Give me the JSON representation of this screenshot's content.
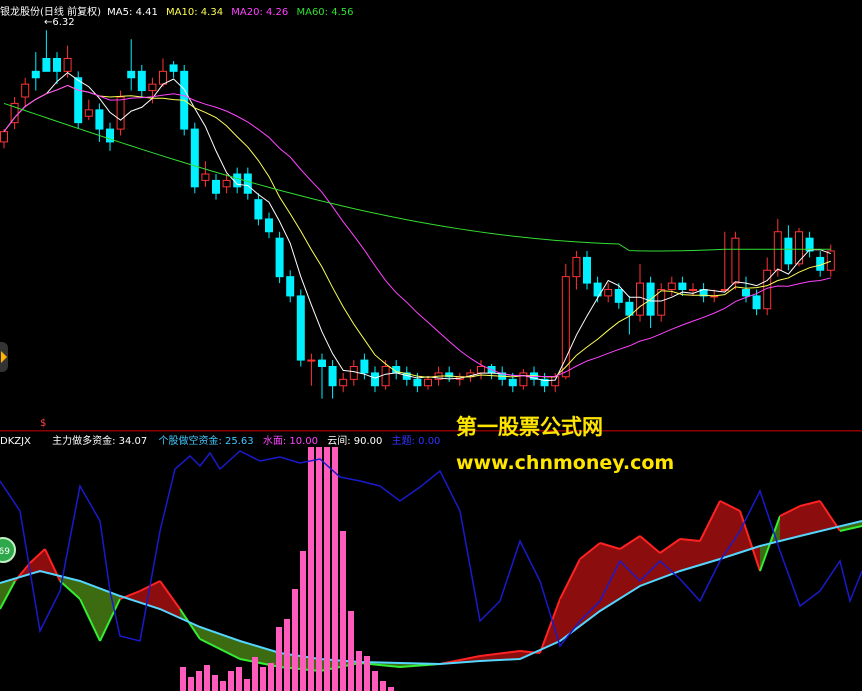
{
  "price_panel": {
    "title": "银龙股份(日线 前复权)",
    "ma_labels": [
      {
        "name": "MA5",
        "value": "4.41",
        "color": "#ffffff"
      },
      {
        "name": "MA10",
        "value": "4.34",
        "color": "#ffff55"
      },
      {
        "name": "MA20",
        "value": "4.26",
        "color": "#ff44ff"
      },
      {
        "name": "MA60",
        "value": "4.56",
        "color": "#33dd33"
      }
    ],
    "high_marker": "6.32",
    "up_color": "#ff3333",
    "down_color": "#00f0ff"
  },
  "indicator_panel": {
    "name": "DKZJX",
    "labels": [
      {
        "text": "主力做多资金: 34.07",
        "color": "#ffffff"
      },
      {
        "text": "个股做空资金: 25.63",
        "color": "#41c8ff"
      },
      {
        "text": "水面: 10.00",
        "color": "#ff44ff"
      },
      {
        "text": "云间: 90.00",
        "color": "#ffffff"
      },
      {
        "text": "主题: 0.00",
        "color": "#3333ff"
      }
    ],
    "side_badge": "69",
    "marker": "$"
  },
  "watermark": {
    "line1": "第一股票公式网",
    "line2": "www.chnmoney.com"
  },
  "chart_data": {
    "type": "candlestick",
    "price_axis_hint": "approx 3.4 - 6.4",
    "series": [
      {
        "name": "MA5",
        "color": "#ffffff"
      },
      {
        "name": "MA10",
        "color": "#ffff55"
      },
      {
        "name": "MA20",
        "color": "#ff44ff"
      },
      {
        "name": "MA60",
        "color": "#33dd33"
      }
    ],
    "candles": [
      [
        5.45,
        5.53,
        5.55,
        5.4
      ],
      [
        5.6,
        5.75,
        5.8,
        5.55
      ],
      [
        5.8,
        5.9,
        5.95,
        5.72
      ],
      [
        6.0,
        5.95,
        6.15,
        5.85
      ],
      [
        6.1,
        6.0,
        6.32,
        6.05
      ],
      [
        6.1,
        6.0,
        6.15,
        5.9
      ],
      [
        6.0,
        6.1,
        6.2,
        5.95
      ],
      [
        5.95,
        5.6,
        6.0,
        5.55
      ],
      [
        5.65,
        5.7,
        5.78,
        5.62
      ],
      [
        5.7,
        5.55,
        5.75,
        5.45
      ],
      [
        5.55,
        5.45,
        5.6,
        5.38
      ],
      [
        5.55,
        5.8,
        5.85,
        5.5
      ],
      [
        6.0,
        5.95,
        6.25,
        5.85
      ],
      [
        6.0,
        5.85,
        6.05,
        5.8
      ],
      [
        5.85,
        5.9,
        5.95,
        5.75
      ],
      [
        5.9,
        6.0,
        6.1,
        5.88
      ],
      [
        6.05,
        6.0,
        6.08,
        5.95
      ],
      [
        6.0,
        5.55,
        6.05,
        5.5
      ],
      [
        5.55,
        5.1,
        5.6,
        5.05
      ],
      [
        5.15,
        5.2,
        5.3,
        5.1
      ],
      [
        5.15,
        5.05,
        5.2,
        5.0
      ],
      [
        5.1,
        5.15,
        5.2,
        5.05
      ],
      [
        5.2,
        5.1,
        5.25,
        5.05
      ],
      [
        5.2,
        5.05,
        5.25,
        5.0
      ],
      [
        5.0,
        4.85,
        5.05,
        4.8
      ],
      [
        4.85,
        4.75,
        4.9,
        4.7
      ],
      [
        4.7,
        4.4,
        4.75,
        4.35
      ],
      [
        4.4,
        4.25,
        4.45,
        4.2
      ],
      [
        4.25,
        3.75,
        4.3,
        3.7
      ],
      [
        3.75,
        3.75,
        3.8,
        3.55
      ],
      [
        3.75,
        3.7,
        3.8,
        3.45
      ],
      [
        3.7,
        3.55,
        3.75,
        3.45
      ],
      [
        3.55,
        3.6,
        3.65,
        3.5
      ],
      [
        3.6,
        3.7,
        3.75,
        3.55
      ],
      [
        3.75,
        3.65,
        3.8,
        3.6
      ],
      [
        3.65,
        3.55,
        3.7,
        3.5
      ],
      [
        3.55,
        3.7,
        3.75,
        3.52
      ],
      [
        3.7,
        3.65,
        3.75,
        3.6
      ],
      [
        3.65,
        3.6,
        3.7,
        3.55
      ],
      [
        3.6,
        3.55,
        3.65,
        3.5
      ],
      [
        3.55,
        3.6,
        3.62,
        3.52
      ],
      [
        3.6,
        3.65,
        3.7,
        3.55
      ],
      [
        3.65,
        3.62,
        3.7,
        3.58
      ],
      [
        3.6,
        3.62,
        3.65,
        3.55
      ],
      [
        3.62,
        3.65,
        3.68,
        3.58
      ],
      [
        3.65,
        3.7,
        3.75,
        3.6
      ],
      [
        3.7,
        3.65,
        3.72,
        3.6
      ],
      [
        3.65,
        3.6,
        3.7,
        3.55
      ],
      [
        3.6,
        3.55,
        3.65,
        3.5
      ],
      [
        3.55,
        3.65,
        3.68,
        3.52
      ],
      [
        3.65,
        3.6,
        3.7,
        3.55
      ],
      [
        3.6,
        3.55,
        3.65,
        3.5
      ],
      [
        3.55,
        3.62,
        3.65,
        3.5
      ],
      [
        3.62,
        4.4,
        4.5,
        3.6
      ],
      [
        4.4,
        4.55,
        4.6,
        4.3
      ],
      [
        4.55,
        4.35,
        4.6,
        4.3
      ],
      [
        4.35,
        4.25,
        4.4,
        4.2
      ],
      [
        4.25,
        4.3,
        4.35,
        4.2
      ],
      [
        4.3,
        4.2,
        4.35,
        4.15
      ],
      [
        4.2,
        4.1,
        4.25,
        3.95
      ],
      [
        4.1,
        4.35,
        4.5,
        4.05
      ],
      [
        4.35,
        4.1,
        4.4,
        4.0
      ],
      [
        4.1,
        4.3,
        4.35,
        4.05
      ],
      [
        4.3,
        4.35,
        4.4,
        4.25
      ],
      [
        4.35,
        4.3,
        4.4,
        4.25
      ],
      [
        4.3,
        4.3,
        4.35,
        4.25
      ],
      [
        4.3,
        4.25,
        4.35,
        4.2
      ],
      [
        4.25,
        4.25,
        4.3,
        4.2
      ],
      [
        4.3,
        4.3,
        4.75,
        4.28
      ],
      [
        4.35,
        4.7,
        4.75,
        4.3
      ],
      [
        4.3,
        4.25,
        4.4,
        4.2
      ],
      [
        4.25,
        4.15,
        4.3,
        4.1
      ],
      [
        4.15,
        4.45,
        4.55,
        4.1
      ],
      [
        4.45,
        4.75,
        4.85,
        4.4
      ],
      [
        4.7,
        4.5,
        4.8,
        4.45
      ],
      [
        4.5,
        4.75,
        4.78,
        4.48
      ],
      [
        4.7,
        4.6,
        4.75,
        4.55
      ],
      [
        4.55,
        4.45,
        4.6,
        4.4
      ],
      [
        4.45,
        4.6,
        4.65,
        4.4
      ]
    ]
  }
}
